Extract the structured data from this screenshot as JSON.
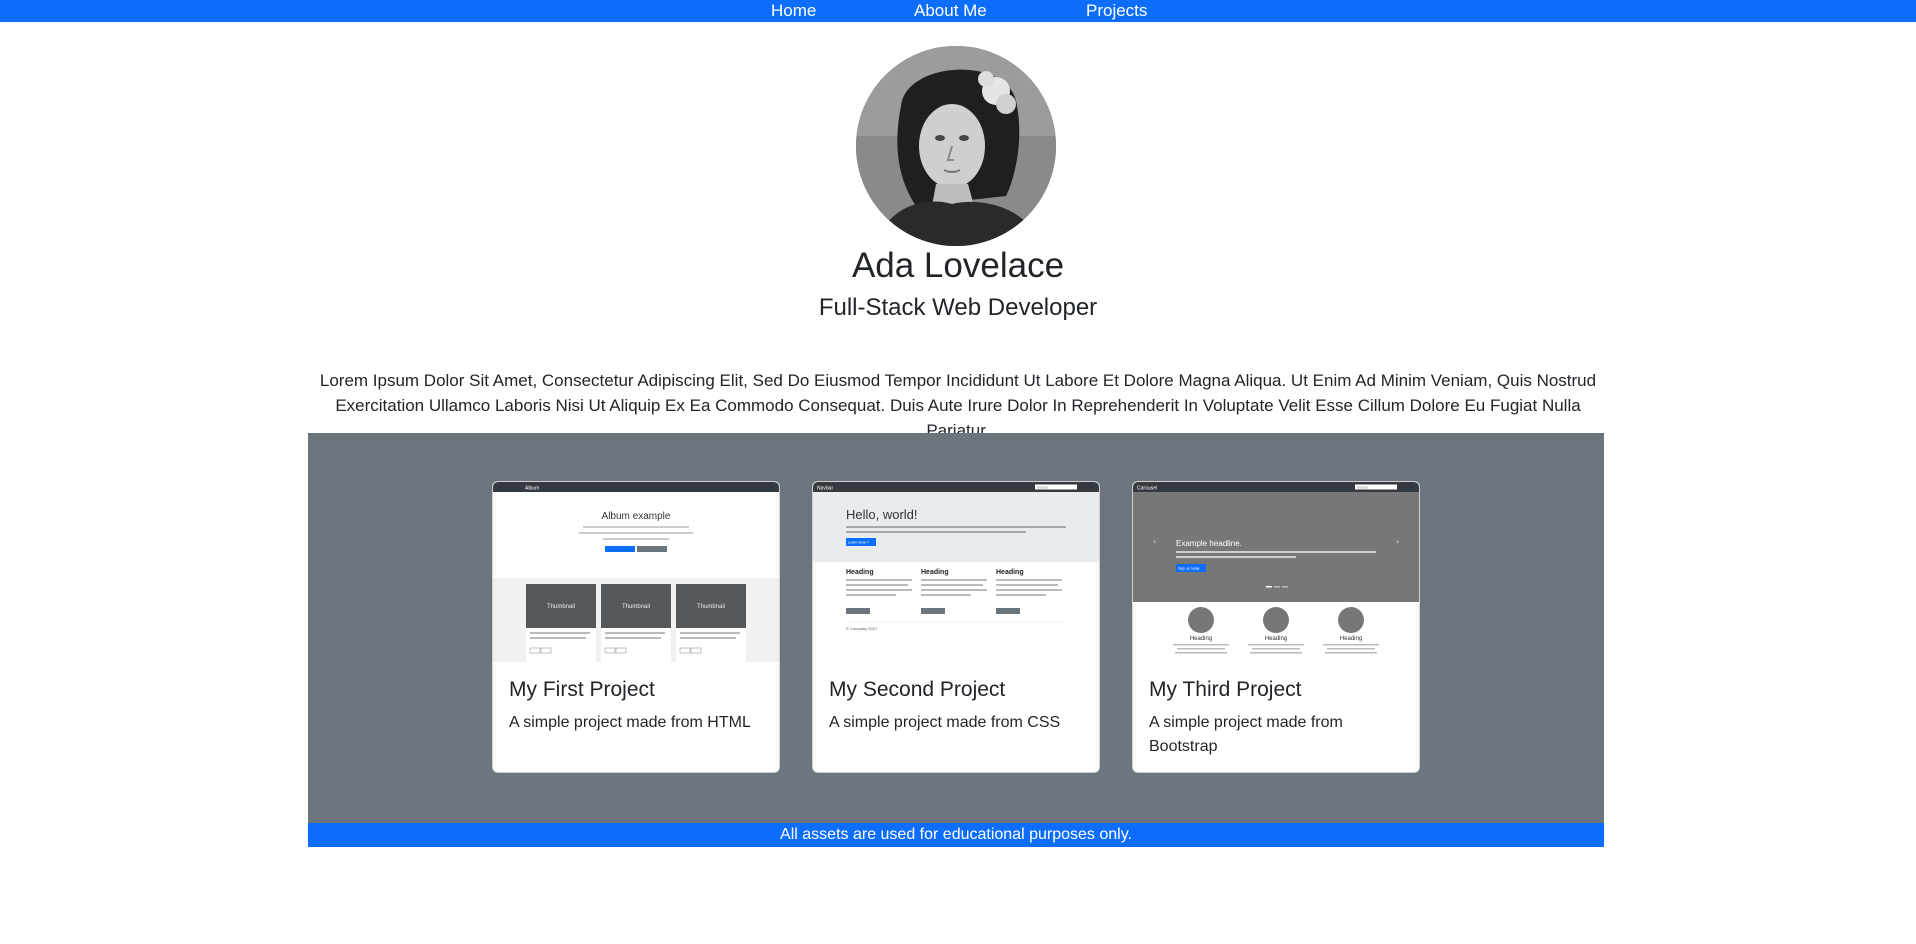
{
  "nav": {
    "items": [
      {
        "label": "Home"
      },
      {
        "label": "About Me"
      },
      {
        "label": "Projects"
      }
    ]
  },
  "profile": {
    "name": "Ada Lovelace",
    "role": "Full-Stack Web Developer",
    "bio": "Lorem Ipsum Dolor Sit Amet, Consectetur Adipiscing Elit, Sed Do Eiusmod Tempor Incididunt Ut Labore Et Dolore Magna Aliqua. Ut Enim Ad Minim Veniam, Quis Nostrud Exercitation Ullamco Laboris Nisi Ut Aliquip Ex Ea Commodo Consequat. Duis Aute Irure Dolor In Reprehenderit In Voluptate Velit Esse Cillum Dolore Eu Fugiat Nulla Pariatur."
  },
  "projects": [
    {
      "title": "My First Project",
      "text": "A simple project made from HTML",
      "thumb": {
        "brand": "Album",
        "heading": "Album example",
        "thumbnail_labels": [
          "Thumbnail",
          "Thumbnail",
          "Thumbnail"
        ]
      }
    },
    {
      "title": "My Second Project",
      "text": "A simple project made from CSS",
      "thumb": {
        "brand": "Navbar",
        "search": "Search",
        "heading": "Hello, world!",
        "button": "Learn more »",
        "col_headings": [
          "Heading",
          "Heading",
          "Heading"
        ],
        "footer": "© Company 2017"
      }
    },
    {
      "title": "My Third Project",
      "text": "A simple project made from Bootstrap",
      "thumb": {
        "brand": "Carousel",
        "search": "Search",
        "heading": "Example headline.",
        "button": "Sign up today",
        "col_headings": [
          "Heading",
          "Heading",
          "Heading"
        ]
      }
    }
  ],
  "footer": {
    "text": "All assets are used for educational purposes only."
  },
  "colors": {
    "primary": "#0d6efd",
    "section_bg": "#6c757d",
    "text": "#212529"
  }
}
